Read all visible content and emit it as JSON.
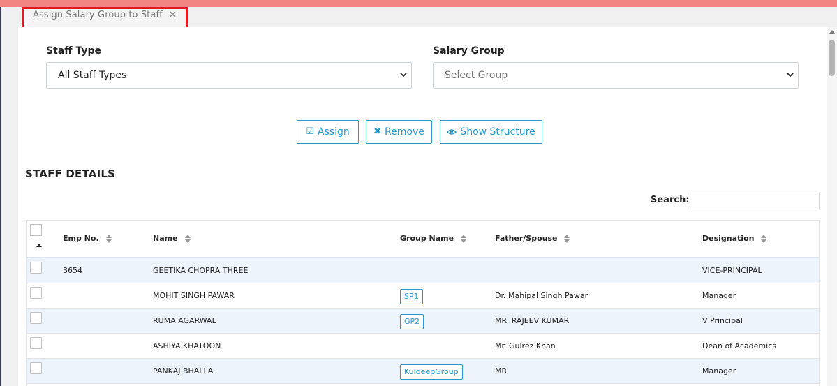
{
  "tab": {
    "title": "Assign Salary Group to Staff"
  },
  "form": {
    "staff_type": {
      "label": "Staff Type",
      "value": "All Staff Types"
    },
    "salary_group": {
      "label": "Salary Group",
      "value": "Select Group"
    }
  },
  "buttons": {
    "assign": "Assign",
    "remove": "Remove",
    "show_structure": "Show Structure"
  },
  "section": {
    "title": "STAFF DETAILS"
  },
  "search": {
    "label": "Search:",
    "value": ""
  },
  "table": {
    "columns": [
      "Emp No.",
      "Name",
      "Group Name",
      "Father/Spouse",
      "Designation"
    ],
    "rows": [
      {
        "emp_no": "3654",
        "name": "GEETIKA CHOPRA THREE",
        "group": "",
        "father": "",
        "designation": "VICE-PRINCIPAL"
      },
      {
        "emp_no": "",
        "name": "MOHIT SINGH PAWAR",
        "group": "SP1",
        "father": "Dr. Mahipal Singh Pawar",
        "designation": "Manager"
      },
      {
        "emp_no": "",
        "name": "RUMA AGARWAL",
        "group": "GP2",
        "father": "MR. RAJEEV KUMAR",
        "designation": "V Principal"
      },
      {
        "emp_no": "",
        "name": "ASHIYA KHATOON",
        "group": "",
        "father": "Mr. Gulrez Khan",
        "designation": "Dean of Academics"
      },
      {
        "emp_no": "",
        "name": "PANKAJ BHALLA",
        "group": "KuldeepGroup",
        "father": "MR",
        "designation": "Manager"
      }
    ]
  },
  "colors": {
    "accent": "#2a98c9",
    "top_bar": "#f28482",
    "highlight_border": "#e01b24",
    "row_alt": "#edf4fb"
  },
  "icons": {
    "assign": "check-square-icon",
    "remove": "times-icon",
    "show_structure": "eye-icon",
    "close": "close-icon",
    "sort": "sort-icon"
  }
}
